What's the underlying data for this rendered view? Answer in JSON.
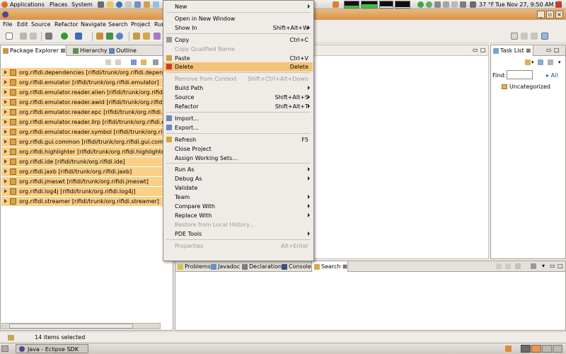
{
  "panel": {
    "applications": "Applications",
    "places": "Places",
    "system": "System",
    "weather": "37 °F",
    "clock": "Tue Nov 27,  9:50 AM"
  },
  "menubar": [
    "File",
    "Edit",
    "Source",
    "Refactor",
    "Navigate",
    "Search",
    "Project",
    "Run"
  ],
  "package_explorer": {
    "tabs": [
      "Package Explorer",
      "Hierarchy",
      "Outline"
    ],
    "items": [
      "org.rifidi.dependencies [rifidi/trunk/org.rifidi.dependencies]",
      "org.rifidi.emulator [rifidi/trunk/org.rifidi.emulator]",
      "org.rifidi.emulator.reader.alien [rifidi/trunk/org.rifidi.emulat",
      "org.rifidi.emulator.reader.awid [rifidi/trunk/org.rifidi.emulat",
      "org.rifidi.emulator.reader.epc [rifidi/trunk/org.rifidi.emulato",
      "org.rifidi.emulator.reader.llrp [rifidi/trunk/org.rifidi.emulato",
      "org.rifidi.emulator.reader.symbol [rifidi/trunk/org.rifidi.emu",
      "org.rifidi.gui.common [rifidi/trunk/org.rifidi.gui.common]",
      "org.rifidi.highlighter [rifidi/trunk/org.rifidi.highlighter]",
      "org.rifidi.ide [rifidi/trunk/org.rifidi.ide]",
      "org.rifidi.jaxb [rifidi/trunk/org.rifidi.jaxb]",
      "org.rifidi.jmeswt [rifidi/trunk/org.rifidi.jmeswt]",
      "org.rifidi.log4j [rifidi/trunk/org.rifidi.log4j]",
      "org.rifidi.streamer [rifidi/trunk/org.rifidi.streamer]"
    ]
  },
  "context_menu": {
    "items": [
      {
        "label": "New",
        "shortcut": "",
        "submenu": true,
        "disabled": false
      },
      {
        "sep": true
      },
      {
        "label": "Open in New Window",
        "shortcut": "",
        "submenu": false,
        "disabled": false
      },
      {
        "label": "Show In",
        "shortcut": "Shift+Alt+W",
        "submenu": true,
        "disabled": false
      },
      {
        "sep": true
      },
      {
        "label": "Copy",
        "shortcut": "Ctrl+C",
        "submenu": false,
        "disabled": false,
        "icon": "copy-icon"
      },
      {
        "label": "Copy Qualified Name",
        "shortcut": "",
        "submenu": false,
        "disabled": true
      },
      {
        "label": "Paste",
        "shortcut": "Ctrl+V",
        "submenu": false,
        "disabled": false,
        "icon": "paste-icon"
      },
      {
        "label": "Delete",
        "shortcut": "Delete",
        "submenu": false,
        "disabled": false,
        "highlight": true,
        "icon": "delete-icon"
      },
      {
        "sep": true
      },
      {
        "label": "Remove from Context",
        "shortcut": "Shift+Ctrl+Alt+Down",
        "submenu": false,
        "disabled": true
      },
      {
        "label": "Build Path",
        "shortcut": "",
        "submenu": true,
        "disabled": false
      },
      {
        "label": "Source",
        "shortcut": "Shift+Alt+S",
        "submenu": true,
        "disabled": false
      },
      {
        "label": "Refactor",
        "shortcut": "Shift+Alt+T",
        "submenu": true,
        "disabled": false
      },
      {
        "sep": true
      },
      {
        "label": "Import...",
        "shortcut": "",
        "submenu": false,
        "disabled": false,
        "icon": "import-icon"
      },
      {
        "label": "Export...",
        "shortcut": "",
        "submenu": false,
        "disabled": false,
        "icon": "export-icon"
      },
      {
        "sep": true
      },
      {
        "label": "Refresh",
        "shortcut": "F5",
        "submenu": false,
        "disabled": false,
        "icon": "refresh-icon"
      },
      {
        "label": "Close Project",
        "shortcut": "",
        "submenu": false,
        "disabled": false
      },
      {
        "label": "Assign Working Sets...",
        "shortcut": "",
        "submenu": false,
        "disabled": false
      },
      {
        "sep": true
      },
      {
        "label": "Run As",
        "shortcut": "",
        "submenu": true,
        "disabled": false
      },
      {
        "label": "Debug As",
        "shortcut": "",
        "submenu": true,
        "disabled": false
      },
      {
        "label": "Validate",
        "shortcut": "",
        "submenu": false,
        "disabled": false
      },
      {
        "label": "Team",
        "shortcut": "",
        "submenu": true,
        "disabled": false
      },
      {
        "label": "Compare With",
        "shortcut": "",
        "submenu": true,
        "disabled": false
      },
      {
        "label": "Replace With",
        "shortcut": "",
        "submenu": true,
        "disabled": false
      },
      {
        "label": "Restore from Local History...",
        "shortcut": "",
        "submenu": false,
        "disabled": true
      },
      {
        "label": "PDE Tools",
        "shortcut": "",
        "submenu": true,
        "disabled": false
      },
      {
        "sep": true
      },
      {
        "label": "Properties",
        "shortcut": "Alt+Enter",
        "submenu": false,
        "disabled": true
      }
    ]
  },
  "task_list": {
    "tab": "Task List",
    "find_label": "Find:",
    "find_value": "",
    "all_link": "All",
    "category": "Uncategorized"
  },
  "bottom_tabs": [
    "Problems",
    "Javadoc",
    "Declaration",
    "Console",
    "Search"
  ],
  "status": {
    "selection": "14 items selected"
  },
  "taskbar": {
    "window_button": "Java - Eclipse SDK"
  },
  "colors": {
    "selection": "#fbcf86",
    "menu_highlight": "#f5c378",
    "title_bar": "#d8924c"
  }
}
